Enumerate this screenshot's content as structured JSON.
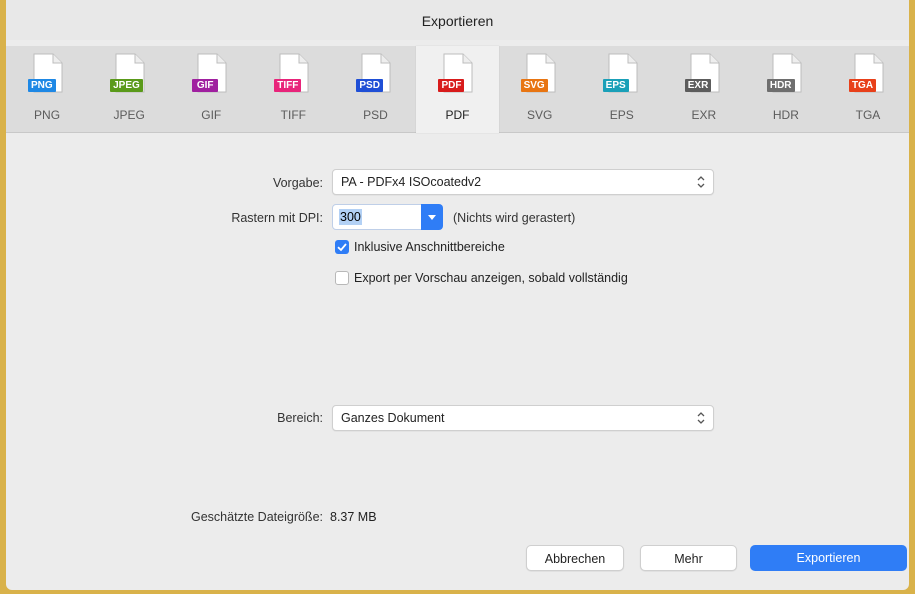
{
  "window": {
    "title": "Exportieren"
  },
  "tabs": [
    {
      "badge": "PNG",
      "label": "PNG",
      "color": "#1e88e5",
      "icon": "png-file-icon",
      "selected": false
    },
    {
      "badge": "JPEG",
      "label": "JPEG",
      "color": "#5a9a1a",
      "icon": "jpeg-file-icon",
      "selected": false
    },
    {
      "badge": "GIF",
      "label": "GIF",
      "color": "#a020a0",
      "icon": "gif-file-icon",
      "selected": false
    },
    {
      "badge": "TIFF",
      "label": "TIFF",
      "color": "#e8247a",
      "icon": "tiff-file-icon",
      "selected": false
    },
    {
      "badge": "PSD",
      "label": "PSD",
      "color": "#1f4fd6",
      "icon": "psd-file-icon",
      "selected": false
    },
    {
      "badge": "PDF",
      "label": "PDF",
      "color": "#d81b1b",
      "icon": "pdf-file-icon",
      "selected": true
    },
    {
      "badge": "SVG",
      "label": "SVG",
      "color": "#e87512",
      "icon": "svg-file-icon",
      "selected": false
    },
    {
      "badge": "EPS",
      "label": "EPS",
      "color": "#1aa0b8",
      "icon": "eps-file-icon",
      "selected": false
    },
    {
      "badge": "EXR",
      "label": "EXR",
      "color": "#5c5c5c",
      "icon": "exr-file-icon",
      "selected": false
    },
    {
      "badge": "HDR",
      "label": "HDR",
      "color": "#6e6e6e",
      "icon": "hdr-file-icon",
      "selected": false
    },
    {
      "badge": "TGA",
      "label": "TGA",
      "color": "#e8401a",
      "icon": "tga-file-icon",
      "selected": false
    }
  ],
  "form": {
    "preset_label": "Vorgabe:",
    "preset_value": "PA - PDFx4 ISOcoatedv2",
    "dpi_label": "Rastern mit DPI:",
    "dpi_value": "300",
    "dpi_note": "(Nichts wird gerastert)",
    "bleed_label": "Inklusive Anschnittbereiche",
    "bleed_checked": true,
    "preview_label": "Export per Vorschau anzeigen, sobald vollständig",
    "preview_checked": false,
    "range_label": "Bereich:",
    "range_value": "Ganzes Dokument",
    "filesize_label": "Geschätzte Dateigröße:",
    "filesize_value": "8.37 MB"
  },
  "buttons": {
    "cancel": "Abbrechen",
    "more": "Mehr",
    "export": "Exportieren"
  },
  "colors": {
    "accent": "#2f7df6"
  }
}
